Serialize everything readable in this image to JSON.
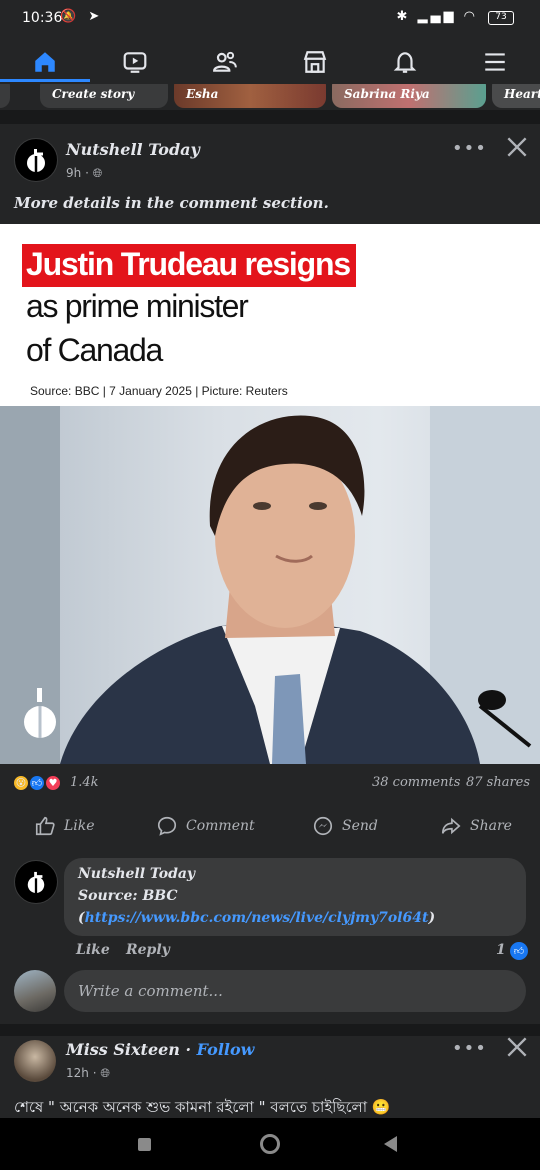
{
  "status_bar": {
    "time": "10:36",
    "battery": "73"
  },
  "nav": {
    "items": [
      "home-icon",
      "video-icon",
      "friends-icon",
      "marketplace-icon",
      "notifications-icon",
      "menu-icon"
    ],
    "accent": "#2d88ff"
  },
  "stories": {
    "create": "Create story",
    "items": [
      "Esha",
      "Sabrina Riya",
      "Hearth"
    ]
  },
  "post1": {
    "author": "Nutshell Today",
    "time": "9h",
    "caption": "More details in the comment section.",
    "card": {
      "headline_red": "Justin Trudeau resigns",
      "headline_line2": "as prime minister",
      "headline_line3": "of Canada",
      "source": "Source: BBC | 7 January 2025 | Picture: Reuters"
    },
    "reactions_count": "1.4k",
    "comments_count": "38 comments",
    "shares_count": "87 shares",
    "actions": {
      "like": "Like",
      "comment": "Comment",
      "send": "Send",
      "share": "Share"
    },
    "comment": {
      "author": "Nutshell Today",
      "line1": "Source: BBC",
      "link_open": "(",
      "link": "https://www.bbc.com/news/live/clyjmy7ol64t",
      "link_close": ")",
      "like": "Like",
      "reply": "Reply",
      "likes": "1"
    },
    "write_placeholder": "Write a comment..."
  },
  "post2": {
    "author": "Miss Sixteen",
    "separator": " · ",
    "follow": "Follow",
    "time": "12h",
    "text": "শেষে \" অনেক অনেক শুভ কামনা রইলো \" বলতে চাইছিলো 😬"
  },
  "colors": {
    "background": "#242526",
    "link": "#4599ff",
    "headline_red": "#e3141b"
  }
}
